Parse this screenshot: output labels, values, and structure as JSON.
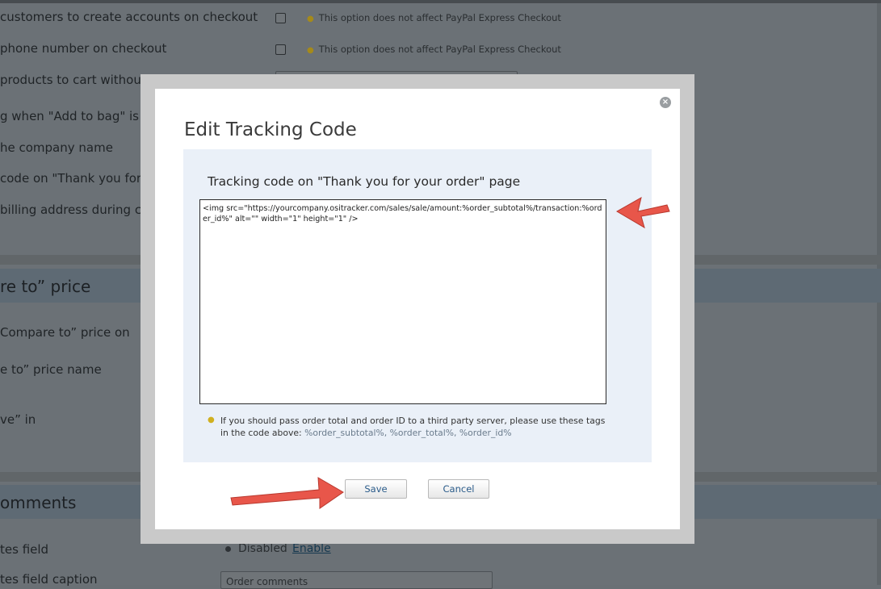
{
  "background": {
    "rows": [
      {
        "label": "customers to create accounts on checkout",
        "hint": "This option does not affect PayPal Express Checkout"
      },
      {
        "label": "phone number on checkout",
        "hint": "This option does not affect PayPal Express Checkout"
      },
      {
        "label": "products to cart without se"
      },
      {
        "label": "g when \"Add to bag\" is cli"
      },
      {
        "label": "he company name"
      },
      {
        "label": "code on \"Thank you for y"
      },
      {
        "label": "billing address during che"
      }
    ],
    "compare_section_title": "re to” price",
    "compare_rows": [
      {
        "label": "Compare to” price on"
      },
      {
        "label": "e to” price name"
      },
      {
        "label": "ve” in"
      }
    ],
    "comments_section_title": "omments",
    "comments_rows": [
      {
        "label": "tes field",
        "status": "Disabled",
        "action": "Enable"
      },
      {
        "label": "tes field caption",
        "input_value": "Order comments"
      }
    ]
  },
  "modal": {
    "title": "Edit Tracking Code",
    "close_glyph": "×",
    "field_label": "Tracking code on \"Thank you for your order\" page",
    "code_value": "<img src=\"https://yourcompany.ositracker.com/sales/sale/amount:%order_subtotal%/transaction:%order_id%\" alt=\"\" width=\"1\" height=\"1\" />",
    "hint_text": "If you should pass order total and order ID to a third party server, please use these tags in the code above: ",
    "hint_tags": "%order_subtotal%, %order_total%, %order_id%",
    "save_label": "Save",
    "cancel_label": "Cancel"
  },
  "icons": {
    "hint": "lightbulb-icon",
    "close": "close-icon",
    "annotation": "red-arrow-icon"
  },
  "colors": {
    "overlay": "#6b7176",
    "modal_frame": "#c9c9c9",
    "panel": "#eaf0f8",
    "button_text": "#2a5b8a",
    "arrow": "#e8564a"
  }
}
